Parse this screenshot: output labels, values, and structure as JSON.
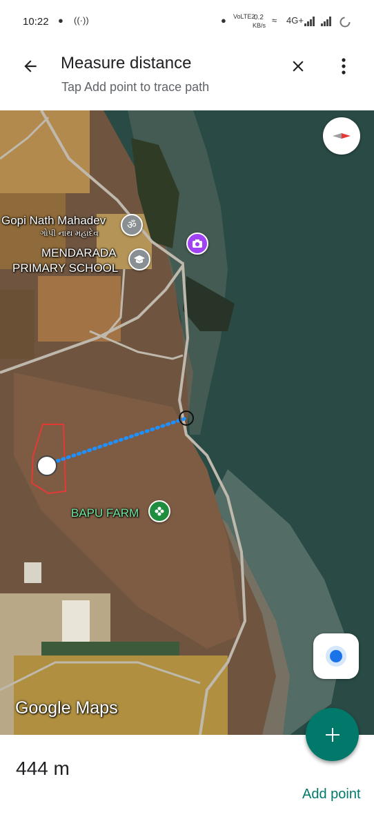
{
  "status_bar": {
    "time": "10:22",
    "network_lte": "VoLTE2",
    "speed_value": "0.2",
    "speed_unit": "KB/s",
    "network_type": "4G+"
  },
  "header": {
    "title": "Measure distance",
    "subtitle": "Tap Add point to trace path",
    "icons": [
      "back-arrow-icon",
      "close-icon",
      "more-vert-icon"
    ]
  },
  "map": {
    "places": [
      {
        "name": "Gopi Nath Mahadev",
        "sub": "ગોપી નાથ મહાદેવ",
        "icon": "om-icon"
      },
      {
        "name_line1": "MENDARADA",
        "name_line2": "PRIMARY SCHOOL",
        "icon": "school-icon"
      },
      {
        "name": "BAPU FARM",
        "icon": "farm-icon"
      },
      {
        "icon": "camera-icon"
      }
    ],
    "watermark": "Google Maps",
    "colors": {
      "path": "#1e90ff",
      "boundary": "#e53935",
      "water": "#284b45",
      "land": "#7b5a3f"
    }
  },
  "measure": {
    "distance": "444 m",
    "add_point_label": "Add point"
  },
  "colors": {
    "accent": "#00796b",
    "location_dot": "#1a73e8"
  }
}
